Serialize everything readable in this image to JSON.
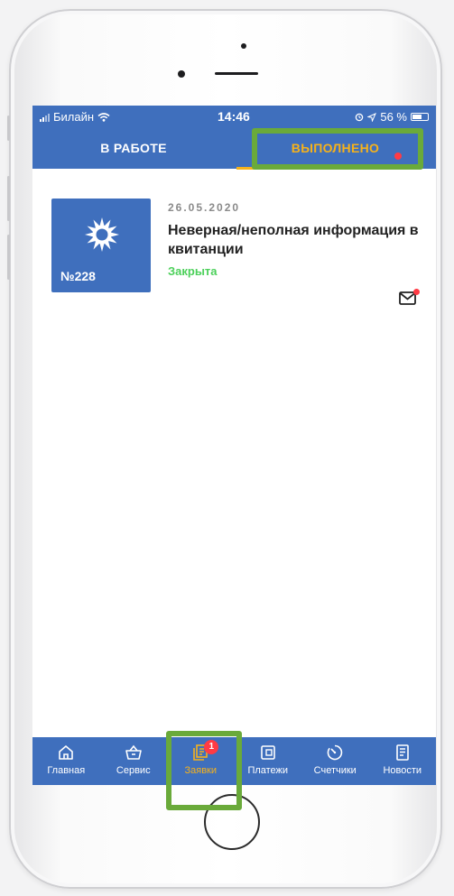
{
  "status_bar": {
    "carrier": "Билайн",
    "time": "14:46",
    "battery": "56 %"
  },
  "tabs": [
    {
      "label": "В РАБОТЕ",
      "active": false
    },
    {
      "label": "ВЫПОЛНЕНО",
      "active": true,
      "has_notification_dot": true
    }
  ],
  "request": {
    "date": "26.05.2020",
    "title": "Неверная/неполная информация в квитанции",
    "status": "Закрыта",
    "number": "№228",
    "logo_icon": "gazprom-flame-logo",
    "message_icon": "mail-icon",
    "has_unread_message": true
  },
  "bottom_nav": {
    "items": [
      {
        "label": "Главная",
        "icon": "home-icon"
      },
      {
        "label": "Сервис",
        "icon": "basket-icon"
      },
      {
        "label": "Заявки",
        "icon": "requests-icon",
        "active": true,
        "badge": "1"
      },
      {
        "label": "Платежи",
        "icon": "wallet-icon"
      },
      {
        "label": "Счетчики",
        "icon": "meter-icon"
      },
      {
        "label": "Новости",
        "icon": "news-icon"
      }
    ]
  },
  "colors": {
    "brand_blue": "#3f6fbd",
    "accent_orange": "#f6b21b",
    "status_green": "#4cd05a",
    "badge_red": "#ff3b45",
    "highlight_green": "#6aaa3a"
  }
}
